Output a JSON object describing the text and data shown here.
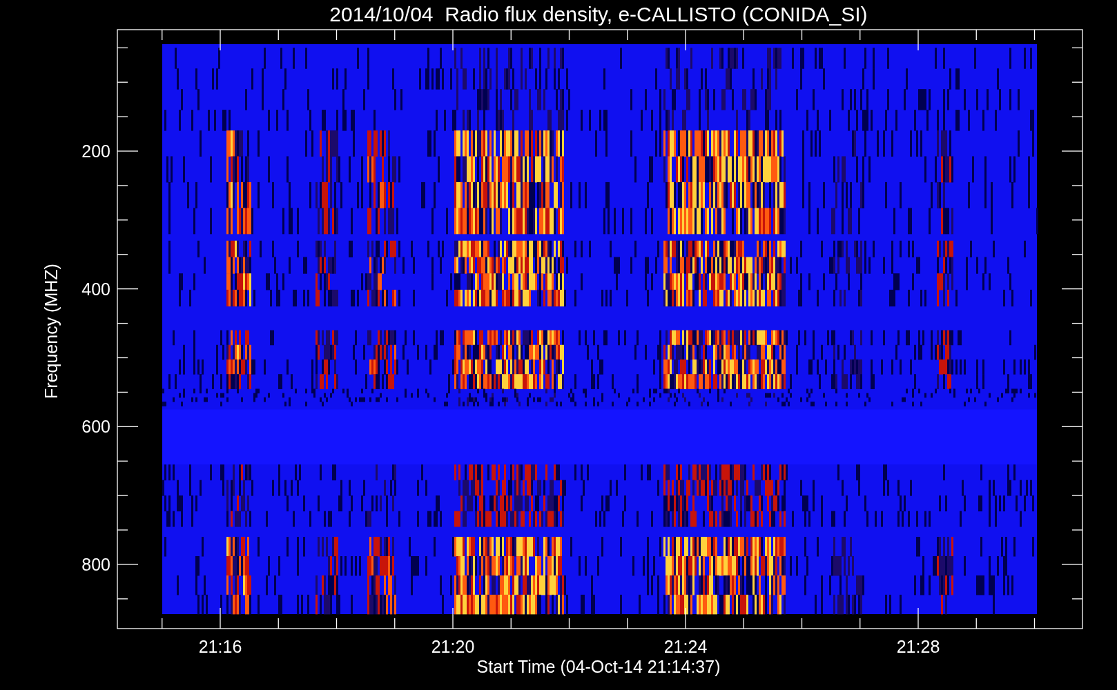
{
  "title": "2014/10/04  Radio flux density, e-CALLISTO (CONIDA_SI)",
  "spectrogram": {
    "ylabel": "Frequency (MHZ)",
    "xlabel": "Start Time (04-Oct-14 21:14:37)",
    "y_tick_labels": [
      "200",
      "400",
      "600",
      "800"
    ],
    "x_tick_labels": [
      "21:16",
      "21:20",
      "21:24",
      "21:28"
    ]
  }
}
